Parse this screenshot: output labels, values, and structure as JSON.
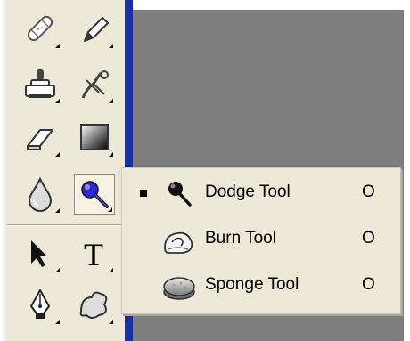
{
  "toolbox": {
    "tools": [
      {
        "name": "healing-brush-tool"
      },
      {
        "name": "pencil-tool"
      },
      {
        "name": "clone-stamp-tool"
      },
      {
        "name": "history-brush-tool"
      },
      {
        "name": "eraser-tool"
      },
      {
        "name": "gradient-tool"
      },
      {
        "name": "blur-tool"
      },
      {
        "name": "dodge-tool",
        "selected": true
      },
      {
        "name": "move-tool"
      },
      {
        "name": "type-tool"
      },
      {
        "name": "pen-tool"
      },
      {
        "name": "custom-shape-tool"
      }
    ]
  },
  "type_tool_glyph": "T",
  "flyout": {
    "items": [
      {
        "label": "Dodge Tool",
        "shortcut": "O",
        "checked": true,
        "icon": "dodge-icon"
      },
      {
        "label": "Burn Tool",
        "shortcut": "O",
        "checked": false,
        "icon": "burn-icon"
      },
      {
        "label": "Sponge Tool",
        "shortcut": "O",
        "checked": false,
        "icon": "sponge-icon"
      }
    ]
  },
  "colors": {
    "panel": "#ece9d8",
    "canvas": "#7e7e7e",
    "accent_blue": "#1b2f9e",
    "tool_highlight": "#2a2ad0"
  }
}
